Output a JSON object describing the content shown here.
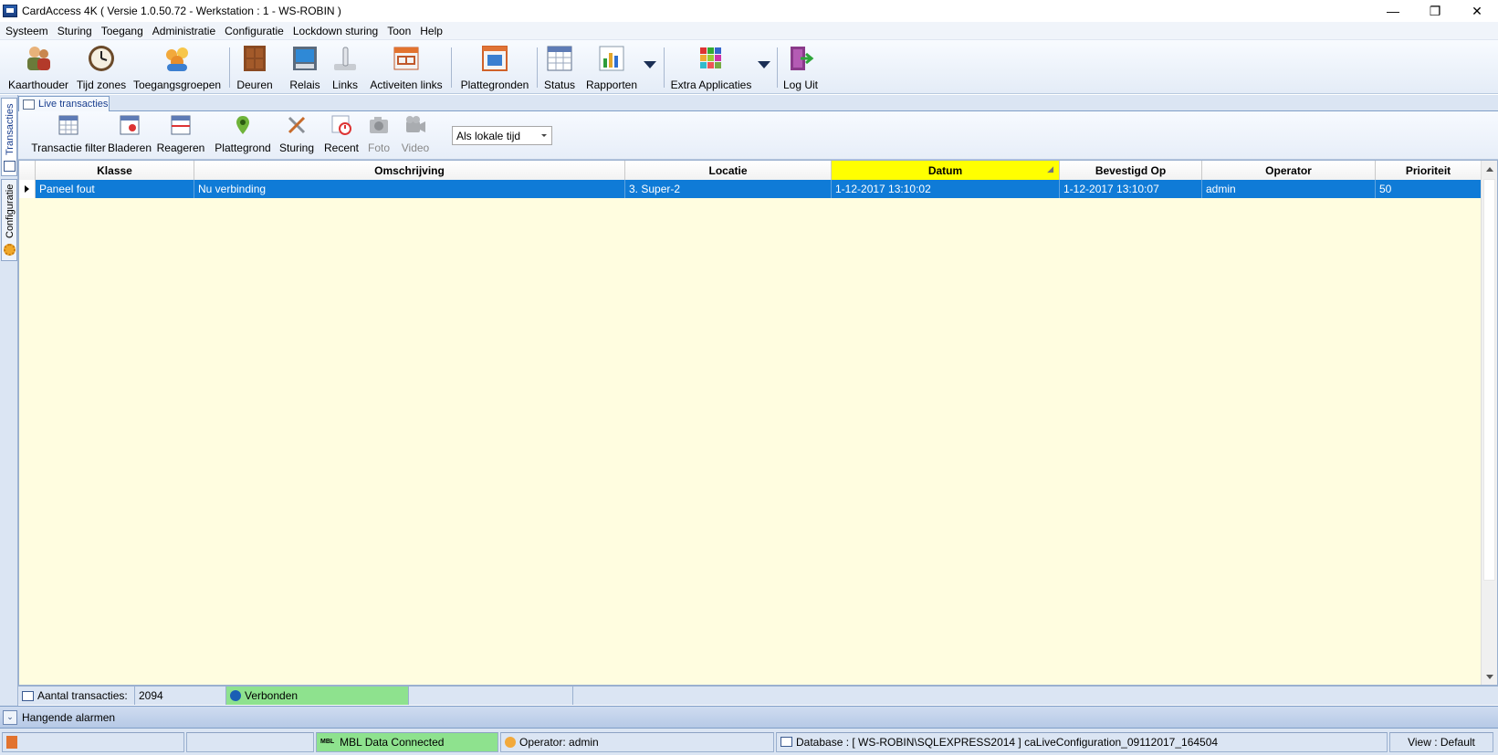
{
  "window": {
    "title": "CardAccess 4K ( Versie 1.0.50.72  -  Werkstation : 1 - WS-ROBIN )",
    "minimize_glyph": "—",
    "maximize_glyph": "❐",
    "close_glyph": "✕"
  },
  "menu": [
    "Systeem",
    "Sturing",
    "Toegang",
    "Administratie",
    "Configuratie",
    "Lockdown sturing",
    "Toon",
    "Help"
  ],
  "toolbar": {
    "kaarthouder": "Kaarthouder",
    "tijd_zones": "Tijd zones",
    "toegangsgroepen": "Toegangsgroepen",
    "deuren": "Deuren",
    "relais": "Relais",
    "links": "Links",
    "activeiten_links": "Activeiten links",
    "plattegronden": "Plattegronden",
    "status": "Status",
    "rapporten": "Rapporten",
    "extra_applicaties": "Extra Applicaties",
    "log_uit": "Log Uit"
  },
  "left_tabs": {
    "transacties": "Transacties",
    "configuratie": "Configuratie"
  },
  "doc_tab": "Live transacties",
  "subtoolbar": {
    "transactie_filter": "Transactie filter",
    "bladeren": "Bladeren",
    "reageren": "Reageren",
    "plattegrond": "Plattegrond",
    "sturing": "Sturing",
    "recent": "Recent",
    "foto": "Foto",
    "video": "Video",
    "time_mode": "Als lokale tijd"
  },
  "grid": {
    "columns": [
      "Klasse",
      "Omschrijving",
      "Locatie",
      "Datum",
      "Bevestigd Op",
      "Operator",
      "Prioriteit"
    ],
    "sorted_column": "Datum",
    "rows": [
      {
        "klasse": "Paneel fout",
        "omschrijving": "Nu verbinding",
        "locatie": "3. Super-2",
        "datum": "1-12-2017 13:10:02",
        "bevestigd_op": "1-12-2017 13:10:07",
        "operator": "admin",
        "prioriteit": "50"
      }
    ]
  },
  "countbar": {
    "label": "Aantal transacties:",
    "value": "2094",
    "connection": "Verbonden"
  },
  "alarms": {
    "label": "Hangende alarmen"
  },
  "statusbar": {
    "mbl": "MBL Data Connected",
    "operator": "Operator: admin",
    "database": "Database : [ WS-ROBIN\\SQLEXPRESS2014 ] caLiveConfiguration_09112017_164504",
    "view": "View : Default"
  },
  "colors": {
    "selection": "#0f7bd7",
    "sorted_header": "#ffff00",
    "grid_background": "#fffde0",
    "connected_green": "#8ee28e",
    "chrome_blue": "#dbe5f3"
  }
}
